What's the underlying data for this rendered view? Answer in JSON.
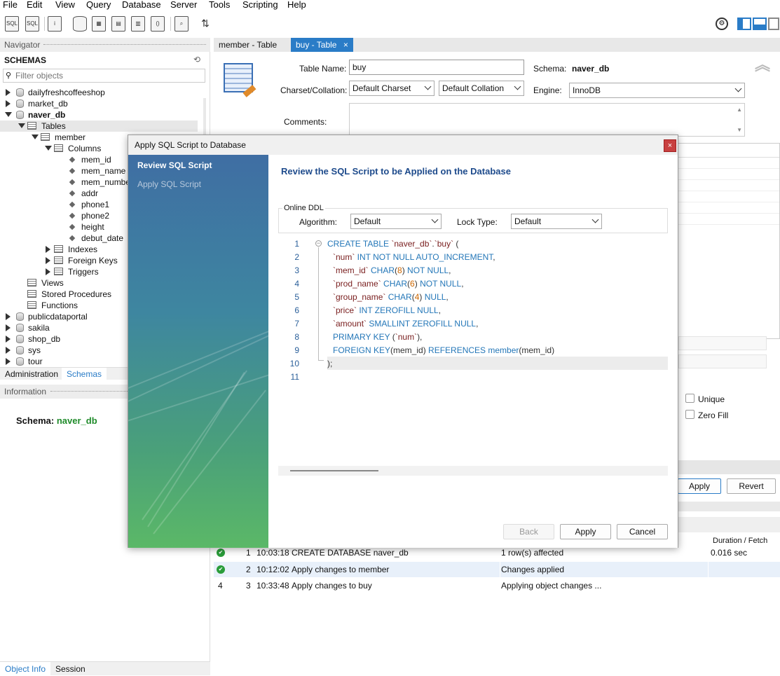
{
  "menu": [
    "File",
    "Edit",
    "View",
    "Query",
    "Database",
    "Server",
    "Tools",
    "Scripting",
    "Help"
  ],
  "navigator": {
    "title": "Navigator",
    "schemas_label": "SCHEMAS",
    "filter_placeholder": "Filter objects",
    "databases_top": [
      "dailyfreshcoffeeshop",
      "market_db",
      "naver_db"
    ],
    "tables_label": "Tables",
    "table_name": "member",
    "columns_label": "Columns",
    "columns": [
      "mem_id",
      "mem_name",
      "mem_number",
      "addr",
      "phone1",
      "phone2",
      "height",
      "debut_date"
    ],
    "table_children": [
      "Indexes",
      "Foreign Keys",
      "Triggers"
    ],
    "schema_children": [
      "Views",
      "Stored Procedures",
      "Functions"
    ],
    "databases_bottom": [
      "publicdataportal",
      "sakila",
      "shop_db",
      "sys",
      "tour"
    ],
    "bottom_tabs": [
      "Administration",
      "Schemas"
    ]
  },
  "information": {
    "title": "Information",
    "schema_label": "Schema:",
    "schema_value": "naver_db",
    "bottom_tabs": [
      "Object Info",
      "Session"
    ]
  },
  "editor_tabs": [
    {
      "label": "member - Table"
    },
    {
      "label": "buy - Table",
      "close": "×"
    }
  ],
  "table_editor": {
    "table_name_label": "Table Name:",
    "table_name_value": "buy",
    "schema_label": "Schema:",
    "schema_value": "naver_db",
    "charset_label": "Charset/Collation:",
    "charset_value": "Default Charset",
    "collation_value": "Default Collation",
    "engine_label": "Engine:",
    "engine_value": "InnoDB",
    "comments_label": "Comments:",
    "unique_label": "Unique",
    "zerofill_label": "Zero Fill",
    "apply_label": "Apply",
    "revert_label": "Revert"
  },
  "dialog": {
    "title": "Apply SQL Script to Database",
    "close": "×",
    "steps": [
      "Review SQL Script",
      "Apply SQL Script"
    ],
    "heading": "Review the SQL Script to be Applied on the Database",
    "online_ddl_label": "Online DDL",
    "algorithm_label": "Algorithm:",
    "algorithm_value": "Default",
    "lock_type_label": "Lock Type:",
    "lock_type_value": "Default",
    "line_numbers": [
      "1",
      "2",
      "3",
      "4",
      "5",
      "6",
      "7",
      "8",
      "9",
      "10",
      "11"
    ],
    "back_label": "Back",
    "apply_label": "Apply",
    "cancel_label": "Cancel"
  },
  "output": {
    "duration_header": "Duration / Fetch",
    "rows": [
      {
        "index": "1",
        "time": "10:03:18",
        "action": "CREATE DATABASE naver_db",
        "message": "1 row(s) affected",
        "duration": "0.016 sec",
        "status": "ok"
      },
      {
        "index": "2",
        "time": "10:12:02",
        "action": "Apply changes to member",
        "message": "Changes applied",
        "duration": "",
        "status": "ok"
      },
      {
        "index": "3",
        "time": "10:33:48",
        "action": "Apply changes to buy",
        "message": "Applying object changes ...",
        "duration": "",
        "status": "4"
      }
    ]
  },
  "colors": {
    "accent": "#2a7cc7",
    "sql_keyword": "#2477b8",
    "sql_identifier": "#7a2020",
    "sql_number": "#cc6600",
    "schema_green": "#1f8b2a",
    "dialog_heading": "#1e4b8c"
  }
}
